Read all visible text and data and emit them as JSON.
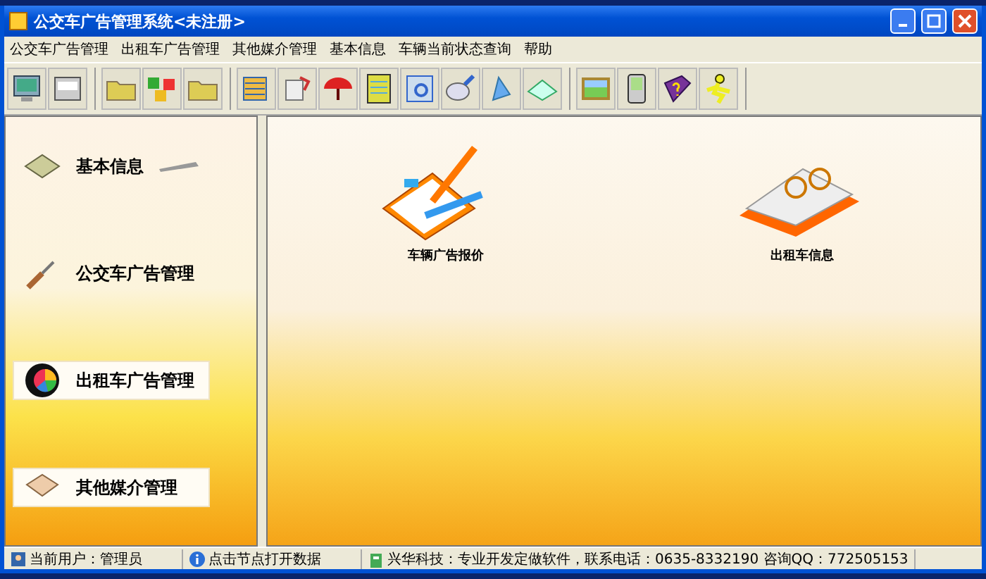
{
  "window": {
    "title": "公交车广告管理系统<未注册>"
  },
  "menu": [
    "公交车广告管理",
    "出租车广告管理",
    "其他媒介管理",
    "基本信息",
    "车辆当前状态查询",
    "帮助"
  ],
  "nav": [
    {
      "label": "基本信息",
      "kind": "info",
      "selected": false
    },
    {
      "label": "公交车广告管理",
      "kind": "bus",
      "selected": false
    },
    {
      "label": "出租车广告管理",
      "kind": "taxi",
      "selected": true
    },
    {
      "label": "其他媒介管理",
      "kind": "other",
      "selected": true
    }
  ],
  "tiles": [
    {
      "label": "车辆广告报价",
      "kind": "clipboard"
    },
    {
      "label": "出租车信息",
      "kind": "book"
    }
  ],
  "status_bar": [
    "当前用户：管理员",
    "点击节点打开数据",
    "兴华科技：专业开发定做软件，联系电话：0635-8332190 咨询QQ：772505153"
  ]
}
